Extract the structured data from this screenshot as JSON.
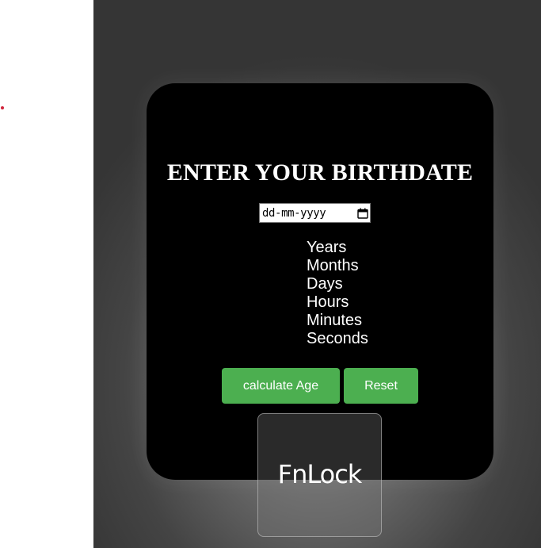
{
  "title": "ENTER YOUR BIRTHDATE",
  "date_input": {
    "placeholder": "dd-mm-yyyy",
    "icon": "calendar-icon"
  },
  "results": [
    {
      "label": "Years"
    },
    {
      "label": "Months"
    },
    {
      "label": "Days"
    },
    {
      "label": "Hours"
    },
    {
      "label": "Minutes"
    },
    {
      "label": "Seconds"
    }
  ],
  "buttons": {
    "calculate_label": "calculate Age",
    "reset_label": "Reset"
  },
  "overlay": {
    "fnlock_label": "FnLock"
  },
  "colors": {
    "button_bg": "#4caf50",
    "card_bg": "#000000",
    "dot": "#d0233a"
  }
}
